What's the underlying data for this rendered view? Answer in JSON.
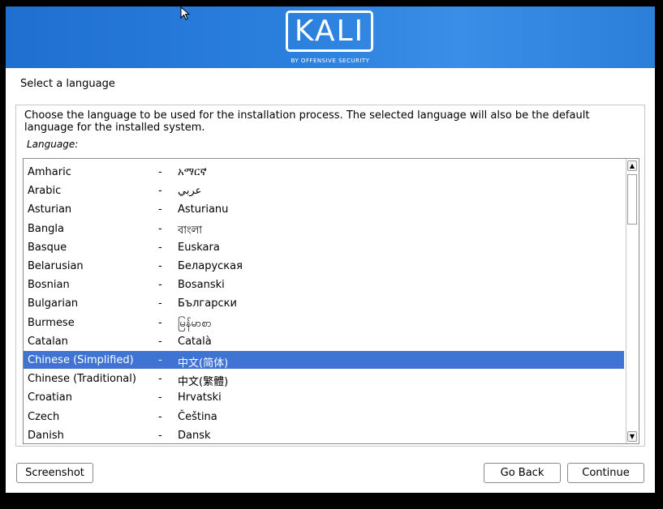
{
  "banner": {
    "logo_text": "KALI",
    "logo_subtitle": "BY OFFENSIVE SECURITY"
  },
  "page_title": "Select a language",
  "description": "Choose the language to be used for the installation process. The selected language will also be the default language for the installed system.",
  "language_label": "Language:",
  "languages": [
    {
      "name": "Amharic",
      "native": "አማርኛ"
    },
    {
      "name": "Arabic",
      "native": "عربي"
    },
    {
      "name": "Asturian",
      "native": "Asturianu"
    },
    {
      "name": "Bangla",
      "native": "বাংলা"
    },
    {
      "name": "Basque",
      "native": "Euskara"
    },
    {
      "name": "Belarusian",
      "native": "Беларуская"
    },
    {
      "name": "Bosnian",
      "native": "Bosanski"
    },
    {
      "name": "Bulgarian",
      "native": "Български"
    },
    {
      "name": "Burmese",
      "native": "မြန်မာစာ"
    },
    {
      "name": "Catalan",
      "native": "Català"
    },
    {
      "name": "Chinese (Simplified)",
      "native": "中文(简体)"
    },
    {
      "name": "Chinese (Traditional)",
      "native": "中文(繁體)"
    },
    {
      "name": "Croatian",
      "native": "Hrvatski"
    },
    {
      "name": "Czech",
      "native": "Čeština"
    },
    {
      "name": "Danish",
      "native": "Dansk"
    }
  ],
  "selected_language": "Chinese (Simplified)",
  "separator": "-",
  "buttons": {
    "screenshot": "Screenshot",
    "go_back": "Go Back",
    "continue": "Continue"
  },
  "colors": {
    "banner": "#2b80de",
    "selection": "#3f73d4"
  }
}
